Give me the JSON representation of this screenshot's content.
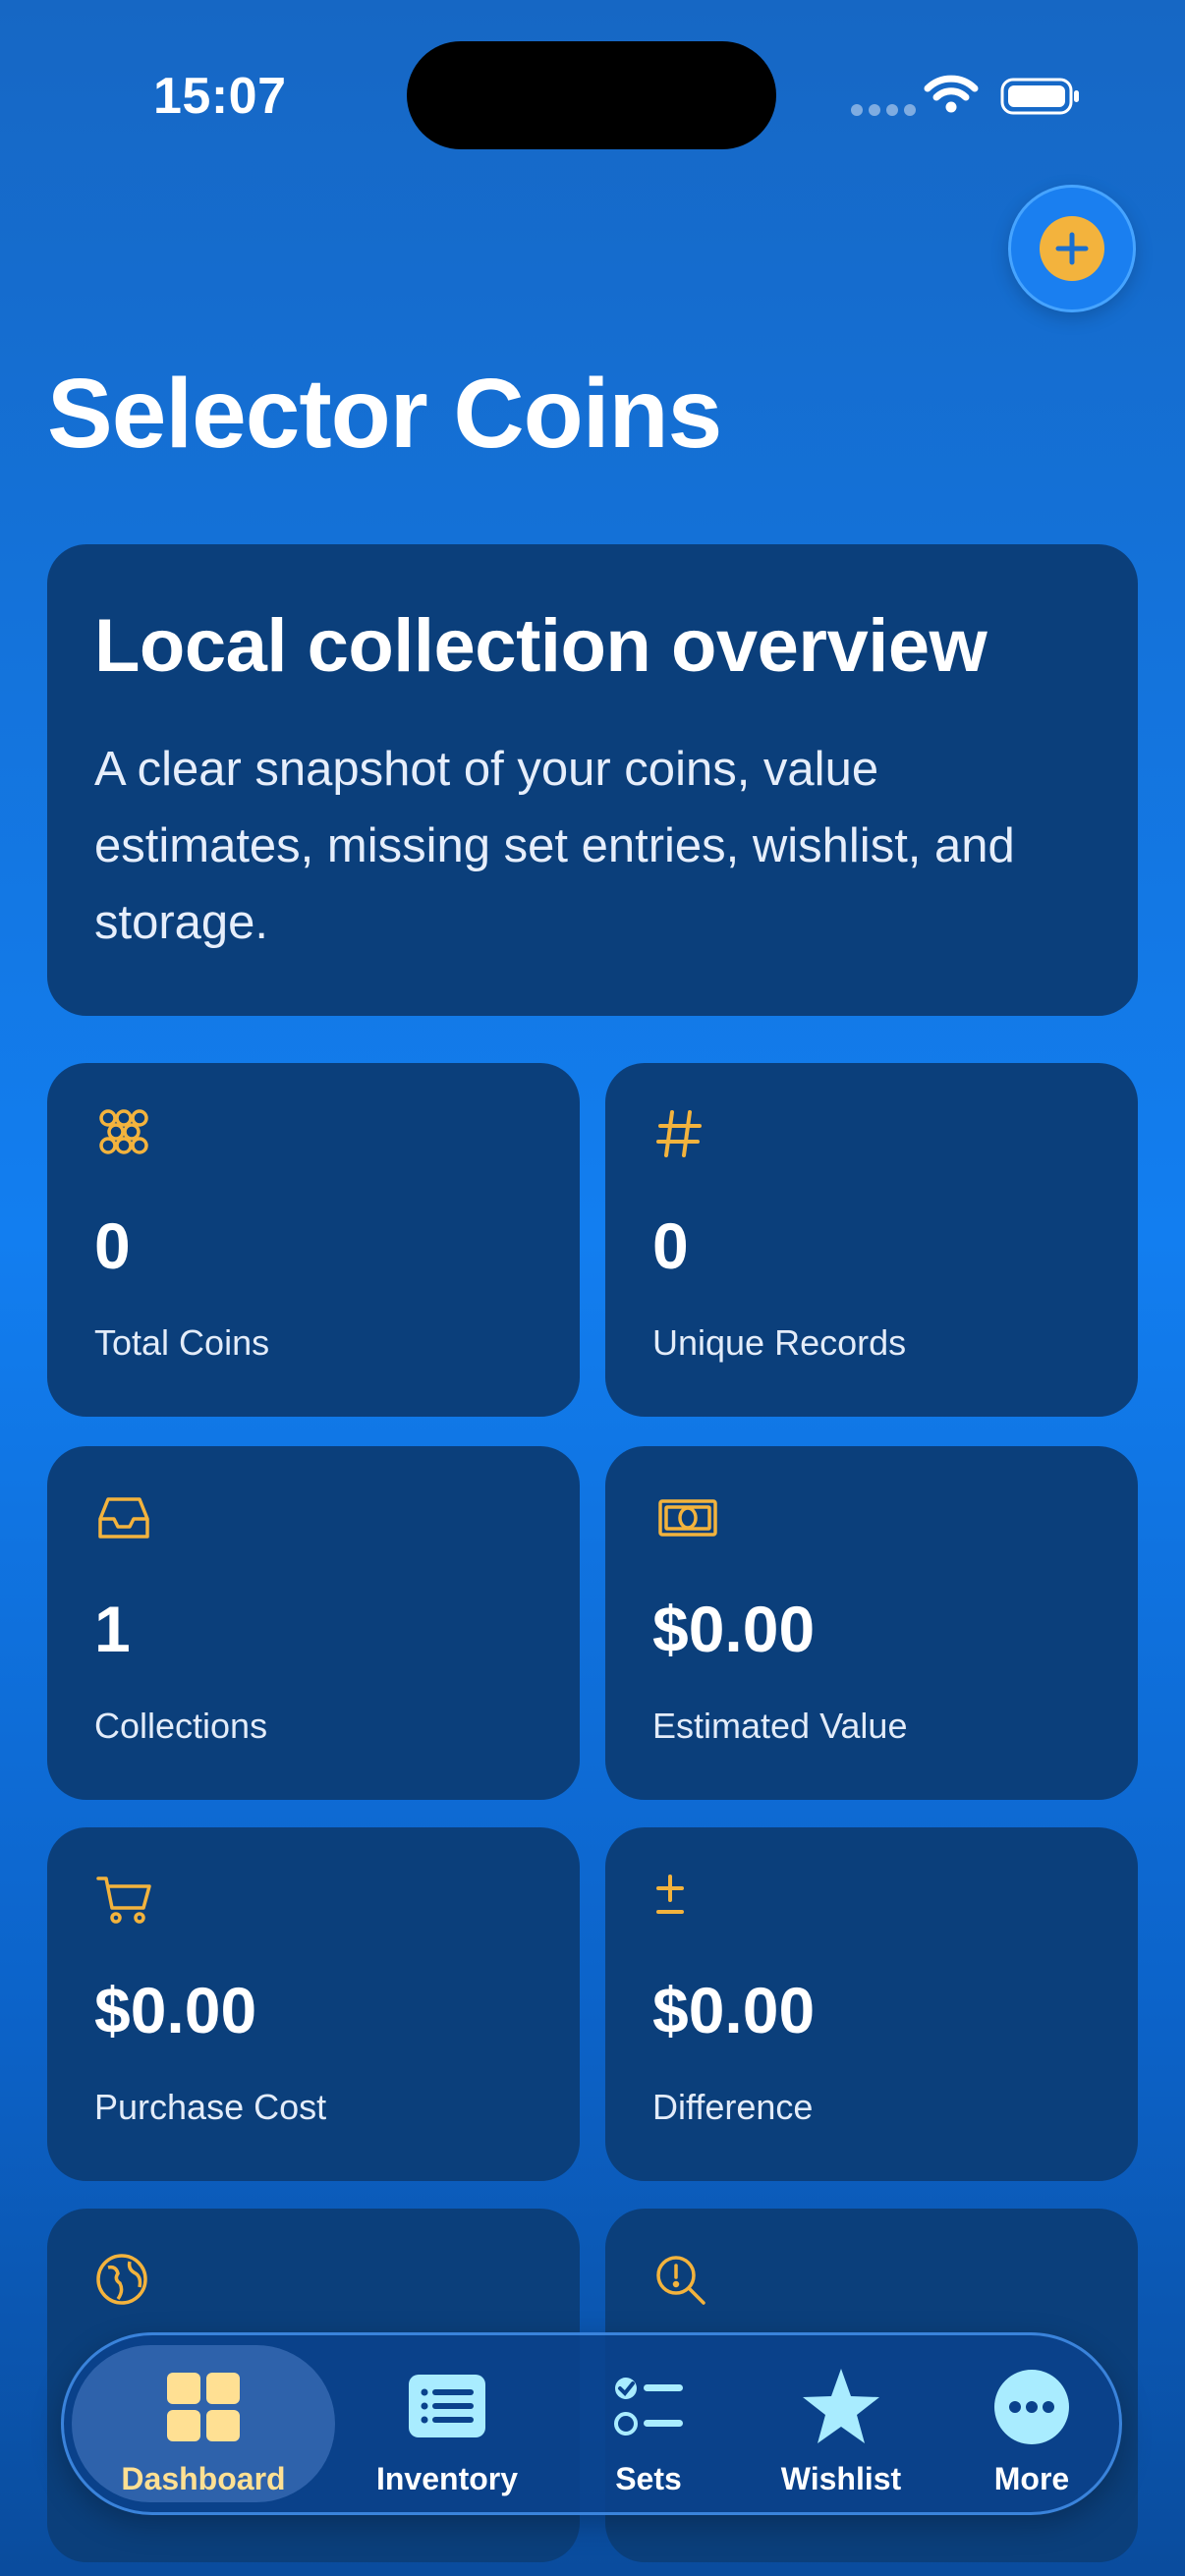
{
  "status_bar": {
    "time": "15:07"
  },
  "header": {
    "title": "Selector Coins"
  },
  "overview": {
    "title": "Local collection overview",
    "description": "A clear snapshot of your coins, value estimates, missing set entries, wishlist, and storage."
  },
  "stats": [
    {
      "icon": "coins-icon",
      "value": "0",
      "label": "Total Coins"
    },
    {
      "icon": "hash-icon",
      "value": "0",
      "label": "Unique Records"
    },
    {
      "icon": "tray-icon",
      "value": "1",
      "label": "Collections"
    },
    {
      "icon": "banknote-icon",
      "value": "$0.00",
      "label": "Estimated Value"
    },
    {
      "icon": "cart-icon",
      "value": "$0.00",
      "label": "Purchase Cost"
    },
    {
      "icon": "plus-minus-icon",
      "value": "$0.00",
      "label": "Difference"
    },
    {
      "icon": "globe-icon",
      "value": "",
      "label": ""
    },
    {
      "icon": "magnifier-alert-icon",
      "value": "",
      "label": ""
    }
  ],
  "tabs": [
    {
      "label": "Dashboard",
      "icon": "dashboard-grid-icon",
      "active": true
    },
    {
      "label": "Inventory",
      "icon": "list-icon",
      "active": false
    },
    {
      "label": "Sets",
      "icon": "checklist-icon",
      "active": false
    },
    {
      "label": "Wishlist",
      "icon": "star-icon",
      "active": false
    },
    {
      "label": "More",
      "icon": "ellipsis-icon",
      "active": false
    }
  ],
  "colors": {
    "accent": "#f3b33d",
    "card": "#0b3f7b",
    "active_tab_label": "#ffe093",
    "tab_icon": "#a9ecff"
  }
}
